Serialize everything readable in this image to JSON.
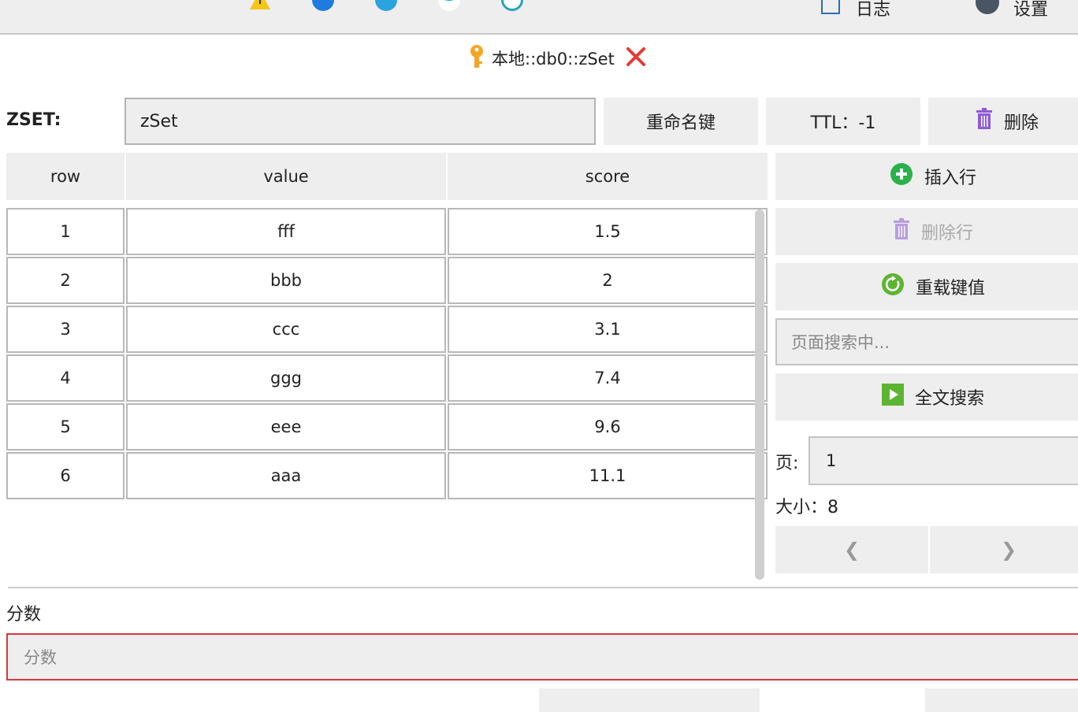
{
  "toolbar": {
    "log_label": "日志",
    "settings_label": "设置"
  },
  "tab": {
    "title": "本地::db0::zSet"
  },
  "key": {
    "type_label": "ZSET:",
    "name": "zSet",
    "rename_label": "重命名键",
    "ttl_label": "TTL：-1",
    "delete_label": "删除"
  },
  "table": {
    "headers": [
      "row",
      "value",
      "score"
    ],
    "rows": [
      {
        "row": "1",
        "value": "fff",
        "score": "1.5"
      },
      {
        "row": "2",
        "value": "bbb",
        "score": "2"
      },
      {
        "row": "3",
        "value": "ccc",
        "score": "3.1"
      },
      {
        "row": "4",
        "value": "ggg",
        "score": "7.4"
      },
      {
        "row": "5",
        "value": "eee",
        "score": "9.6"
      },
      {
        "row": "6",
        "value": "aaa",
        "score": "11.1"
      }
    ]
  },
  "actions": {
    "insert_label": "插入行",
    "delete_row_label": "删除行",
    "reload_label": "重载键值",
    "search_placeholder": "页面搜索中...",
    "fulltext_label": "全文搜索",
    "page_label": "页:",
    "page_value": "1",
    "size_text": "大小：8",
    "prev_glyph": "❮",
    "next_glyph": "❯"
  },
  "editor": {
    "score_label": "分数",
    "score_placeholder": "分数"
  },
  "colors": {
    "accent_green": "#2ab24a",
    "delete_purple": "#8e5bd6",
    "close_red": "#e53935",
    "key_orange": "#f5a623"
  }
}
